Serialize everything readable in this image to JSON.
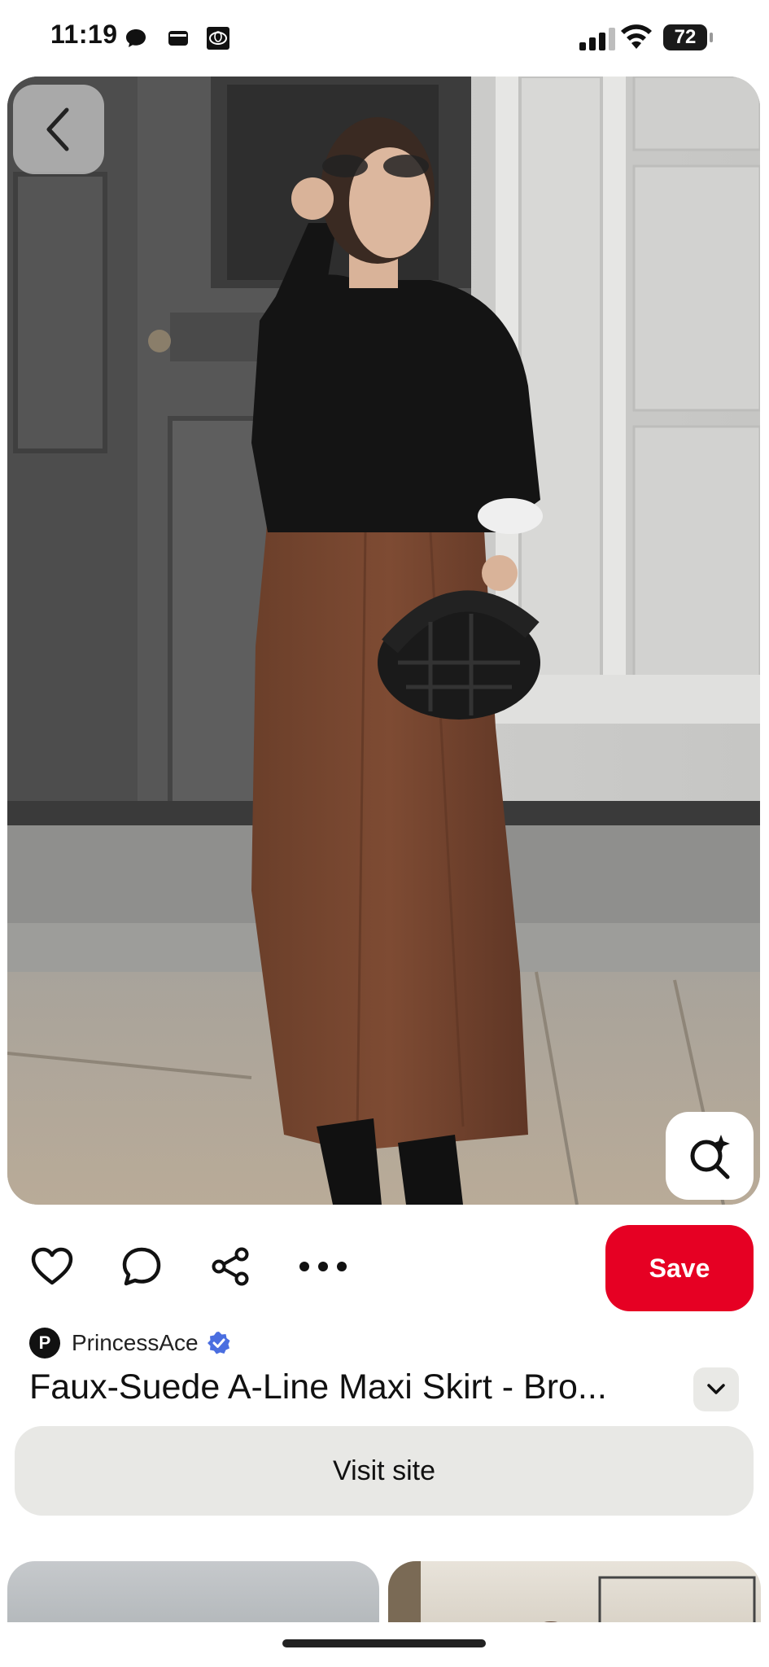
{
  "status_bar": {
    "time": "11:19",
    "battery": "72",
    "icons": [
      "chat-bubble-icon",
      "wallet-icon",
      "car-brand-icon",
      "signal-icon",
      "wifi-icon",
      "battery-icon"
    ]
  },
  "pin": {
    "image_alt": "Woman wearing black sweater and brown faux-suede maxi skirt holding a black woven handbag",
    "creator": {
      "avatar_letter": "P",
      "name": "PrincessAce",
      "verified": true
    },
    "title": "Faux-Suede A-Line Maxi Skirt - Bro..."
  },
  "actions": {
    "save_label": "Save",
    "visit_label": "Visit site",
    "icons": [
      "heart-icon",
      "comment-icon",
      "share-icon",
      "more-icon"
    ]
  },
  "colors": {
    "save_red": "#e60023",
    "verified_blue": "#4a6ee0",
    "button_grey": "#e8e8e5"
  }
}
